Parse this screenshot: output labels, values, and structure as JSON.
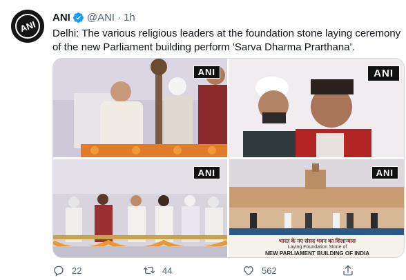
{
  "tweet": {
    "author_name": "ANI",
    "handle": "@ANI",
    "separator": "·",
    "time": "1h",
    "avatar_text": "ANI",
    "text": "Delhi: The various religious leaders at the foundation stone laying ceremony of the new Parliament building perform 'Sarva Dharma Prarthana'."
  },
  "media": {
    "badge": "ANI",
    "banner_line1": "भारत के नए संसद भवन का शिलान्यास",
    "banner_line2": "Laying Foundation Stone of",
    "banner_line3": "NEW PARLIAMENT BUILDING OF INDIA"
  },
  "actions": {
    "reply_count": "22",
    "retweet_count": "44",
    "like_count": "562"
  },
  "colors": {
    "verified": "#1d9bf0",
    "text": "#0f1419",
    "secondary": "#536471"
  }
}
